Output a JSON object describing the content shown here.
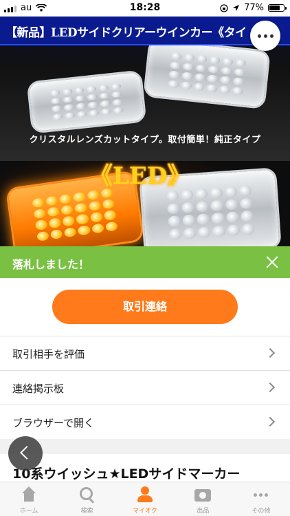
{
  "status_bar": {
    "carrier": "au",
    "time": "18:28",
    "battery": "77%",
    "battery_level": 0.77
  },
  "product_image": {
    "banner_text": "【新品】LEDサイドクリアーウインカー《タイ",
    "caption": "クリスタルレンズカットタイプ。取付簡単！純正タイプ",
    "led_label": "《LED》"
  },
  "banner": {
    "message": "落札しました！"
  },
  "actions": {
    "contact_label": "取引連絡"
  },
  "menu": {
    "items": [
      {
        "label": "取引相手を評価"
      },
      {
        "label": "連絡掲示板"
      },
      {
        "label": "ブラウザーで開く"
      }
    ]
  },
  "item": {
    "title": "10系ウイッシュ★LEDサイドマーカー"
  },
  "tabbar": {
    "items": [
      {
        "label": "ホーム",
        "icon": "home-icon"
      },
      {
        "label": "検索",
        "icon": "search-icon"
      },
      {
        "label": "マイオク",
        "icon": "user-icon"
      },
      {
        "label": "出品",
        "icon": "camera-icon"
      },
      {
        "label": "その他",
        "icon": "more-icon"
      }
    ],
    "active": "マイオク"
  },
  "colors": {
    "banner_green": "#7ac143",
    "accent_orange": "#ff7a1a"
  }
}
